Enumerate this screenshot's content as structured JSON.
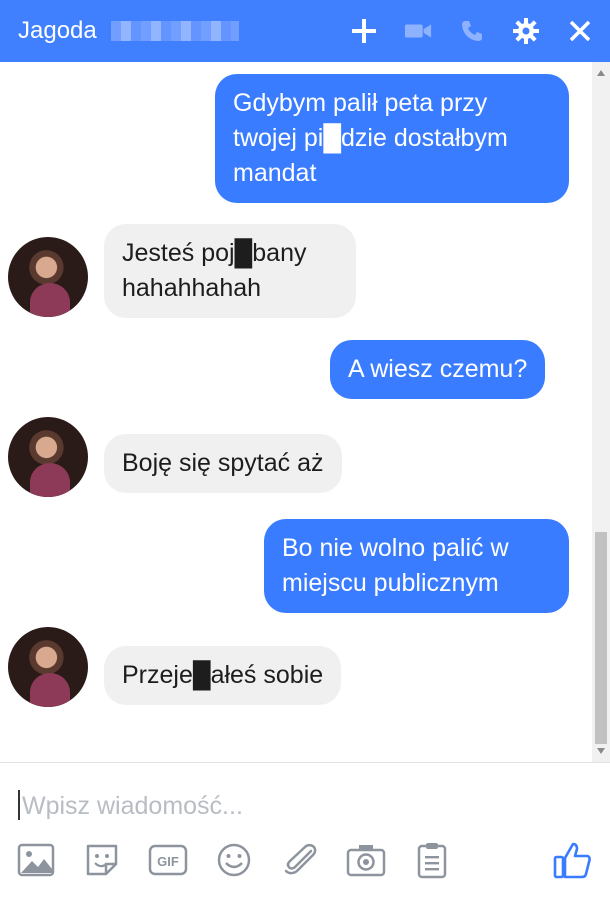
{
  "header": {
    "name": "Jagoda",
    "icons": [
      "plus-icon",
      "video-camera-icon",
      "phone-icon",
      "gear-icon",
      "close-icon"
    ]
  },
  "messages": [
    {
      "from": "me",
      "text": "Gdybym palił peta przy\ntwojej pi█dzie dostałbym\nmandat"
    },
    {
      "from": "them",
      "text": "Jesteś poj█bany\nhahahhahah"
    },
    {
      "from": "me",
      "text": "A wiesz czemu?"
    },
    {
      "from": "them",
      "text": "Boję się spytać aż"
    },
    {
      "from": "me",
      "text": "Bo nie wolno palić w\nmiejscu publicznym"
    },
    {
      "from": "them",
      "text": "Przeje█ałeś sobie"
    }
  ],
  "composer": {
    "placeholder": "Wpisz wiadomość..."
  },
  "toolbar": {
    "icons": [
      "image-icon",
      "sticker-icon",
      "gif-icon",
      "emoji-icon",
      "attachment-icon",
      "camera-icon",
      "clipboard-icon",
      "like-icon"
    ],
    "gif_label": "GIF"
  },
  "colors": {
    "accent": "#4080ff",
    "outgoing_bubble": "#3a7cff",
    "incoming_bubble": "#f1f0f0"
  }
}
